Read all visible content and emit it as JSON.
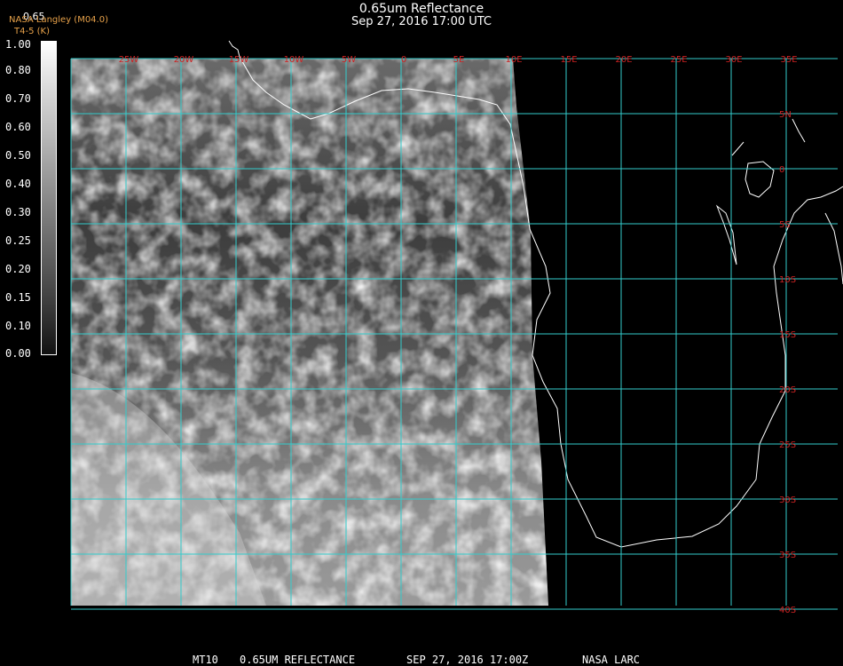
{
  "header": {
    "title": "0.65um Reflectance",
    "subtitle": "Sep 27, 2016 17:00 UTC",
    "org": "NASA Langley (M04.0)",
    "org_sub": "T4-5 (K)",
    "value_readout": "0.65"
  },
  "colorbar": {
    "labels": [
      "1.00",
      "0.80",
      "0.70",
      "0.60",
      "0.50",
      "0.40",
      "0.30",
      "0.25",
      "0.20",
      "0.15",
      "0.10",
      "0.00"
    ]
  },
  "map": {
    "lon_labels": [
      "25W",
      "20W",
      "15W",
      "10W",
      "5W",
      "0",
      "5E",
      "10E",
      "15E",
      "20E",
      "25E",
      "30E",
      "35E"
    ],
    "lat_labels": [
      "5N",
      "0",
      "5S",
      "10S",
      "15S",
      "20S",
      "25S",
      "30S",
      "35S",
      "40S"
    ],
    "grid_color": "#33cccc",
    "label_color": "#cc2222",
    "coast_color": "#ffffff"
  },
  "footer": {
    "satellite": "MT10",
    "product": "0.65UM REFLECTANCE",
    "date": "SEP 27, 2016 17:00Z",
    "source": "NASA LARC"
  }
}
